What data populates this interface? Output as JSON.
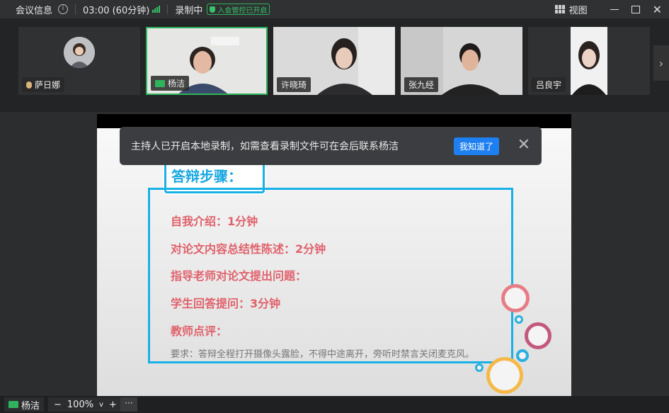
{
  "topbar": {
    "meeting_info": "会议信息",
    "timer": "03:00 (60分钟)",
    "recording": "录制中",
    "lock_badge": "入会管控已开启",
    "view": "视图"
  },
  "participants": [
    {
      "name": "萨日娜"
    },
    {
      "name": "杨洁"
    },
    {
      "name": "许晓琦"
    },
    {
      "name": "张九经"
    },
    {
      "name": "吕良宇"
    }
  ],
  "toast": {
    "message": "主持人已开启本地录制，如需查看录制文件可在会后联系杨洁",
    "ok_label": "我知道了"
  },
  "slide": {
    "title": "答辩步骤：",
    "lines": [
      "自我介绍：1分钟",
      "对论文内容总结性陈述：2分钟",
      "指导老师对论文提出问题：",
      "学生回答提问：3分钟",
      "教师点评："
    ],
    "note": "要求：答辩全程打开摄像头露脸，不得中途离开，旁听时禁言关闭麦克风。"
  },
  "bottombar": {
    "presenter": "杨洁",
    "zoom": "100%",
    "more": "···"
  },
  "colors": {
    "accent": "#18b1e6",
    "slide_text": "#e0626c",
    "green": "#2fb35c"
  }
}
